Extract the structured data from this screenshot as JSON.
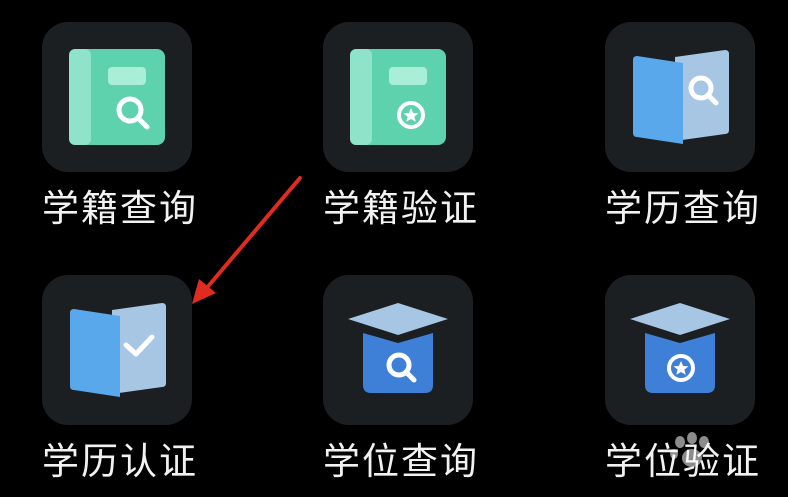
{
  "apps": [
    {
      "label": "学籍查询",
      "icon": "book-search-icon"
    },
    {
      "label": "学籍验证",
      "icon": "book-star-icon"
    },
    {
      "label": "学历查询",
      "icon": "open-book-search-icon"
    },
    {
      "label": "学历认证",
      "icon": "open-book-check-icon"
    },
    {
      "label": "学位查询",
      "icon": "graduation-cap-search-icon"
    },
    {
      "label": "学位验证",
      "icon": "graduation-cap-star-icon"
    }
  ],
  "colors": {
    "background": "#000000",
    "tile": "#1c1f22",
    "green": "#5ed1ad",
    "blue": "#5aa8ec",
    "arrow": "#e02b20"
  }
}
